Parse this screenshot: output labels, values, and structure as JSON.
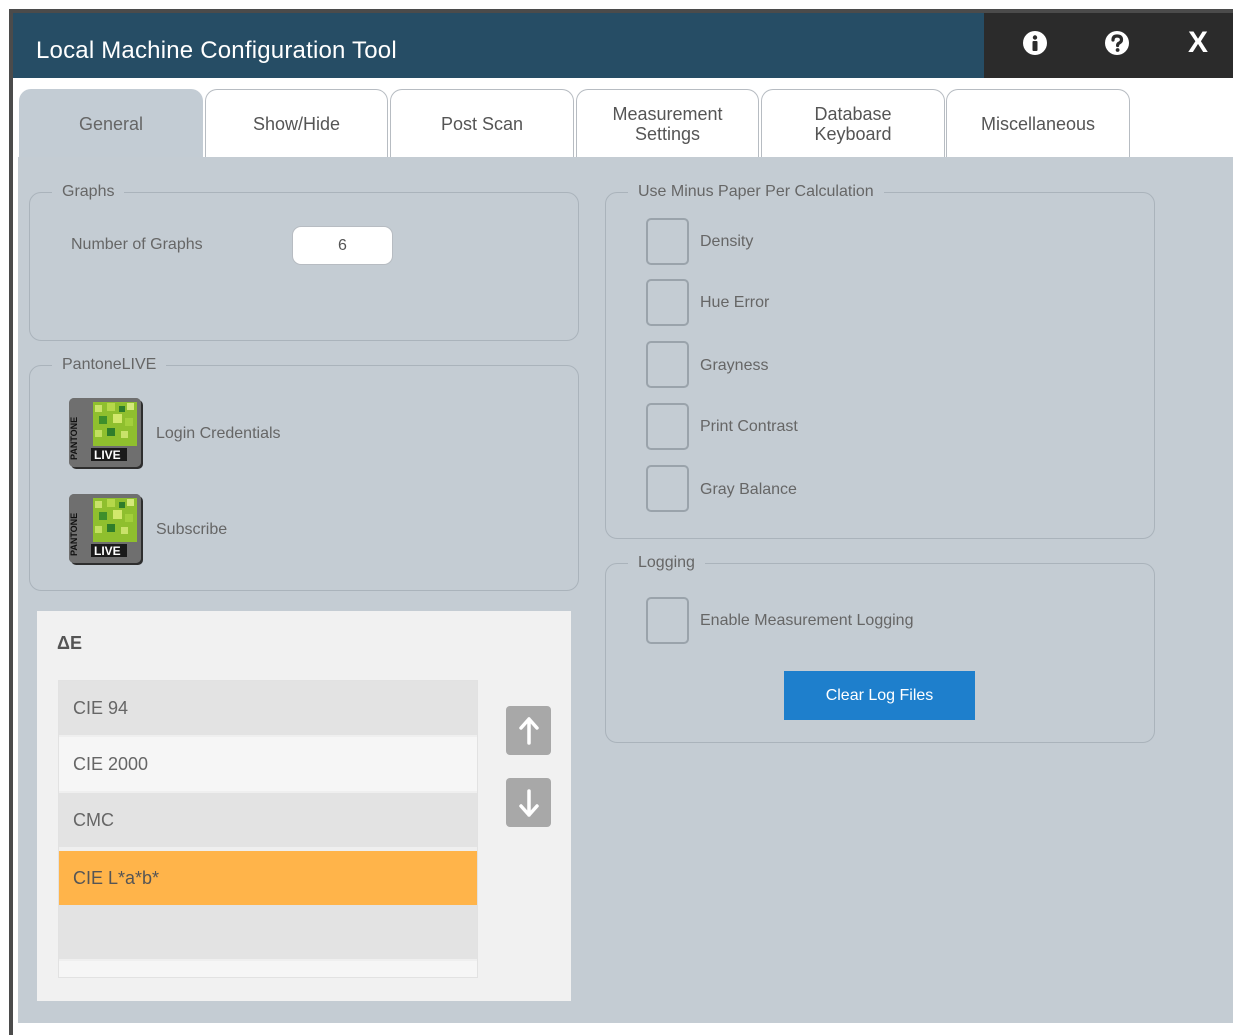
{
  "window": {
    "title": "Local Machine Configuration Tool",
    "close_label": "X"
  },
  "tabs": [
    {
      "label": "General",
      "active": true
    },
    {
      "label": "Show/Hide"
    },
    {
      "label": "Post Scan"
    },
    {
      "label": "Measurement Settings"
    },
    {
      "label": "Database Keyboard"
    },
    {
      "label": "Miscellaneous"
    }
  ],
  "graphs": {
    "legend": "Graphs",
    "number_label": "Number of Graphs",
    "number_value": "6"
  },
  "pantone": {
    "legend": "PantoneLIVE",
    "login_label": "Login Credentials",
    "subscribe_label": "Subscribe",
    "logo_brand": "PANTONE",
    "logo_live": "LIVE"
  },
  "delta_e": {
    "title": "ΔE",
    "items": [
      "CIE 94",
      "CIE 2000",
      "CMC",
      "CIE L*a*b*"
    ],
    "selected": "CIE L*a*b*"
  },
  "minus_paper": {
    "legend": "Use Minus Paper Per Calculation",
    "options": [
      "Density",
      "Hue Error",
      "Grayness",
      "Print Contrast",
      "Gray Balance"
    ]
  },
  "logging": {
    "legend": "Logging",
    "enable_label": "Enable Measurement Logging",
    "clear_button": "Clear Log Files"
  },
  "colors": {
    "titlebar": "#264d65",
    "titlebar_dark": "#2b2b2b",
    "content_bg": "#c4ccd3",
    "accent_blue": "#1e7fcc",
    "selection_orange": "#ffb44a"
  }
}
